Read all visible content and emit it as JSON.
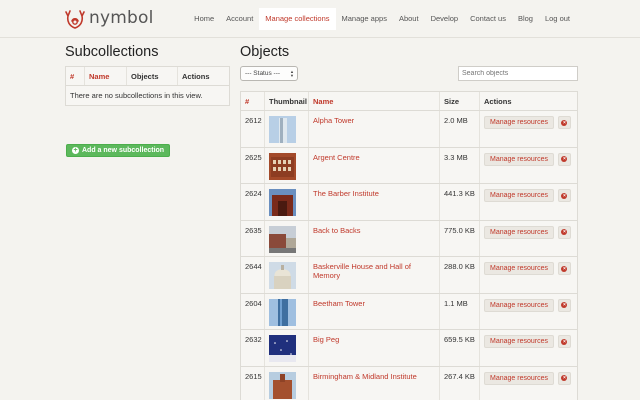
{
  "brand": {
    "name": "nymbol",
    "accent": "#c0392b"
  },
  "nav": {
    "items": [
      {
        "label": "Home"
      },
      {
        "label": "Account"
      },
      {
        "label": "Manage collections",
        "active": true
      },
      {
        "label": "Manage apps"
      },
      {
        "label": "About"
      },
      {
        "label": "Develop"
      },
      {
        "label": "Contact us"
      },
      {
        "label": "Blog"
      },
      {
        "label": "Log out"
      }
    ]
  },
  "subcollections": {
    "title": "Subcollections",
    "columns": [
      "#",
      "Name",
      "Objects",
      "Actions"
    ],
    "empty_text": "There are no subcollections in this view.",
    "add_button": "Add a new subcollection"
  },
  "objects": {
    "title": "Objects",
    "status_select": "--- Status ---",
    "search_placeholder": "Search objects",
    "columns": [
      "#",
      "Thumbnail",
      "Name",
      "Size",
      "Actions"
    ],
    "manage_label": "Manage resources",
    "rows": [
      {
        "id": "2612",
        "name": "Alpha Tower",
        "size": "2.0 MB",
        "thumb": "tower-blue"
      },
      {
        "id": "2625",
        "name": "Argent Centre",
        "size": "3.3 MB",
        "thumb": "brick-building"
      },
      {
        "id": "2624",
        "name": "The Barber Institute",
        "size": "441.3 KB",
        "thumb": "brick-dark"
      },
      {
        "id": "2635",
        "name": "Back to Backs",
        "size": "775.0 KB",
        "thumb": "street"
      },
      {
        "id": "2644",
        "name": "Baskerville House and Hall of Memory",
        "size": "288.0 KB",
        "thumb": "dome"
      },
      {
        "id": "2604",
        "name": "Beetham Tower",
        "size": "1.1 MB",
        "thumb": "tower-glass"
      },
      {
        "id": "2632",
        "name": "Big Peg",
        "size": "659.5 KB",
        "thumb": "night-blue"
      },
      {
        "id": "2615",
        "name": "Birmingham & Midland Institute",
        "size": "267.4 KB",
        "thumb": "brick-tower"
      }
    ]
  }
}
